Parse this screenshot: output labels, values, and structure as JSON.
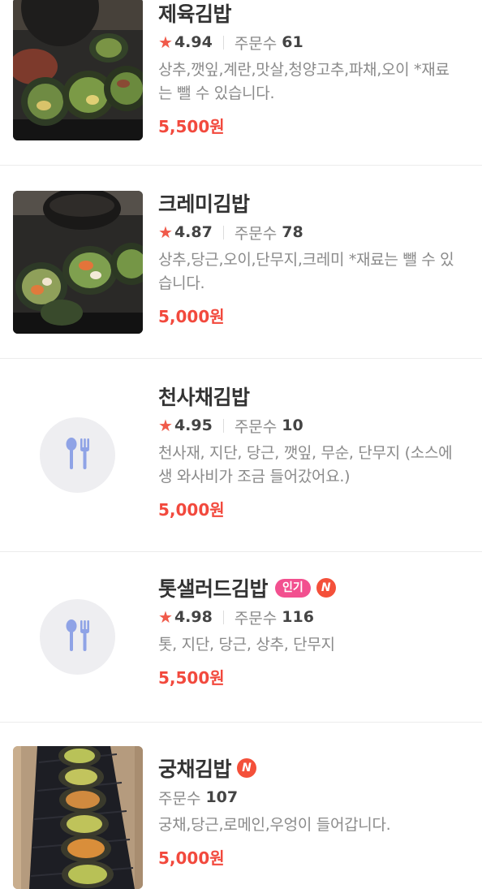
{
  "colors": {
    "accent_price": "#f2493d",
    "star": "#f05a4a",
    "badge_popular": "#f2508f",
    "badge_new": "#f4503a",
    "placeholder_bg": "#eeeef1",
    "placeholder_icon": "#8fa3e6"
  },
  "icons": {
    "rating": "★",
    "placeholder": "fork-spoon-icon",
    "new_badge": "N"
  },
  "menu": {
    "items": [
      {
        "name": "제육김밥",
        "rating": "4.94",
        "orders_label": "주문수",
        "orders_count": "61",
        "description": "상추,깻잎,계란,맛살,청양고추,파채,오이 *재료는 뺄 수 있습니다.",
        "price": "5,500원"
      },
      {
        "name": "크레미김밥",
        "rating": "4.87",
        "orders_label": "주문수",
        "orders_count": "78",
        "description": "상추,당근,오이,단무지,크레미 *재료는 뺄 수 있습니다.",
        "price": "5,000원"
      },
      {
        "name": "천사채김밥",
        "rating": "4.95",
        "orders_label": "주문수",
        "orders_count": "10",
        "description": "천사재, 지단, 당근, 깻잎, 무순, 단무지 (소스에 생 와사비가 조금 들어갔어요.)",
        "price": "5,000원"
      },
      {
        "name": "톳샐러드김밥",
        "badge_popular": "인기",
        "badge_new": "N",
        "rating": "4.98",
        "orders_label": "주문수",
        "orders_count": "116",
        "description": "톳, 지단, 당근, 상추, 단무지",
        "price": "5,500원"
      },
      {
        "name": "궁채김밥",
        "badge_new": "N",
        "orders_label": "주문수",
        "orders_count": "107",
        "description": "궁채,당근,로메인,우엉이 들어갑니다.",
        "price": "5,000원"
      }
    ]
  }
}
